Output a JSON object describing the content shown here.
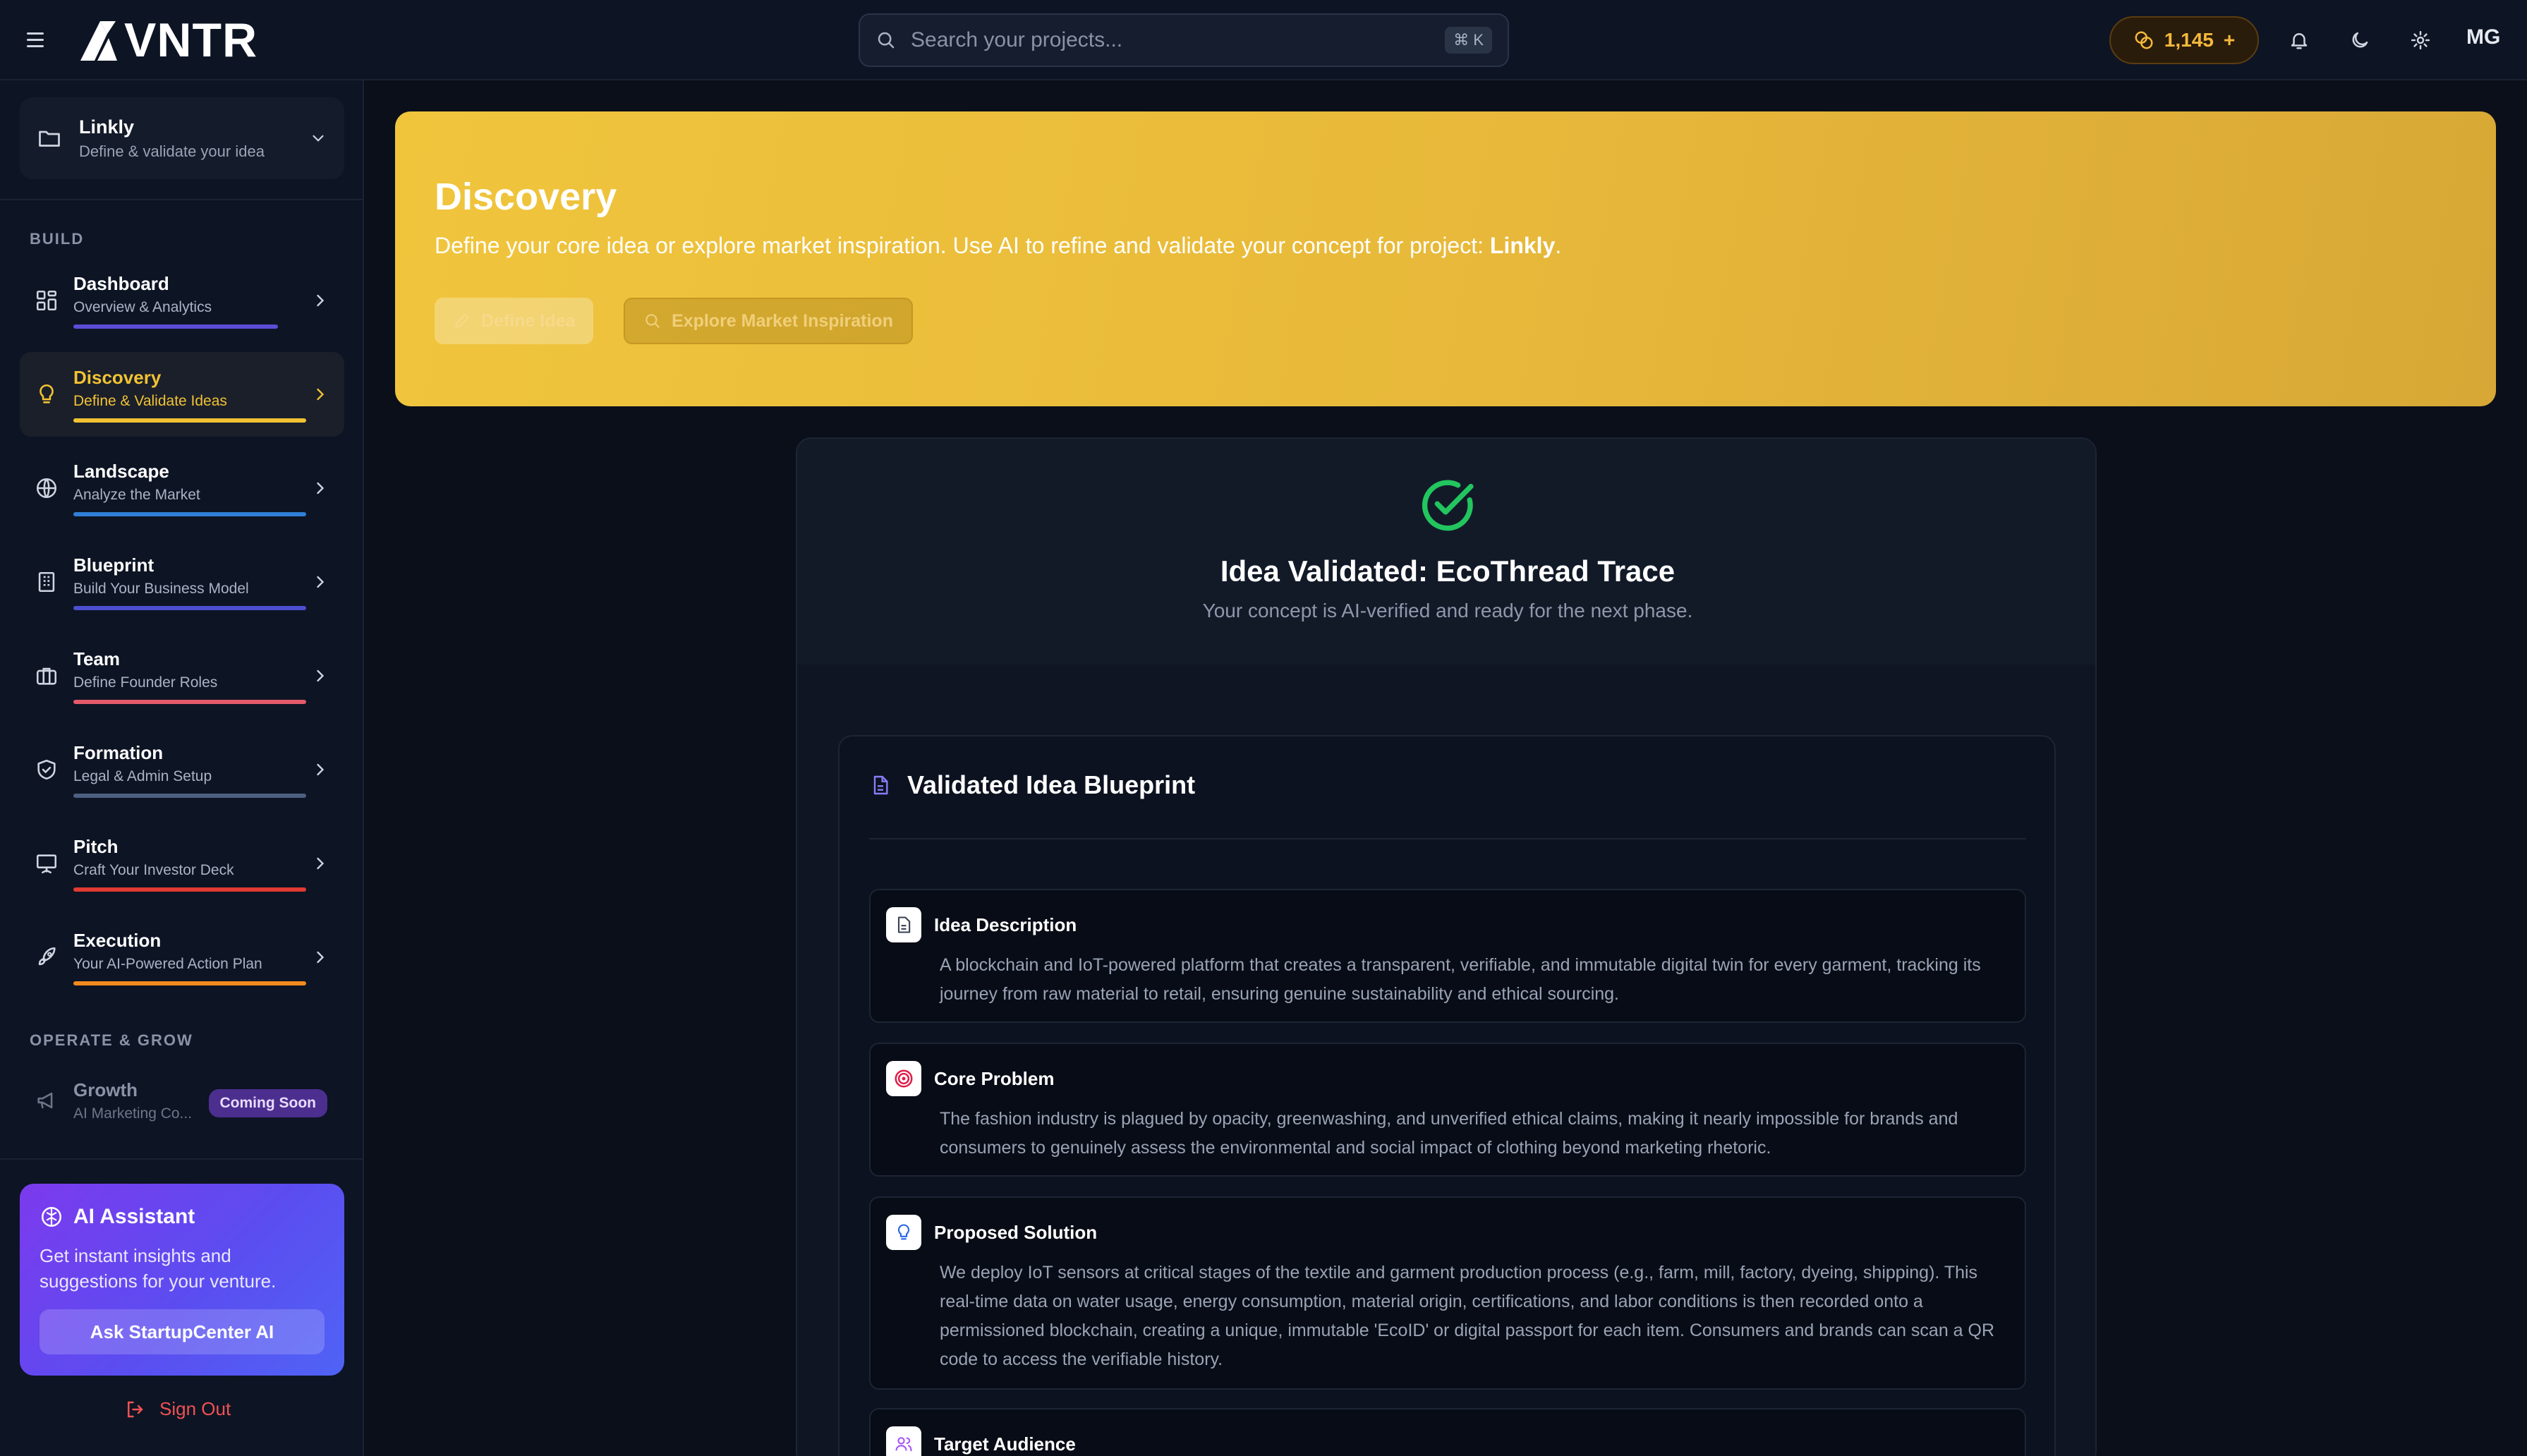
{
  "topbar": {
    "logo": "VNTR",
    "search_placeholder": "Search your projects...",
    "shortcut": "⌘ K",
    "credits": "1,145",
    "credits_plus": "+",
    "avatar": "MG"
  },
  "sidebar": {
    "project": {
      "name": "Linkly",
      "subtitle": "Define & validate your idea"
    },
    "section_build": "BUILD",
    "items": [
      {
        "label": "Dashboard",
        "sub": "Overview & Analytics",
        "color": "#5b4dd6"
      },
      {
        "label": "Discovery",
        "sub": "Define & Validate Ideas",
        "color": "#f2c233"
      },
      {
        "label": "Landscape",
        "sub": "Analyze the Market",
        "color": "#2f7fd6"
      },
      {
        "label": "Blueprint",
        "sub": "Build Your Business Model",
        "color": "#4b4fd0"
      },
      {
        "label": "Team",
        "sub": "Define Founder Roles",
        "color": "#e35a6a"
      },
      {
        "label": "Formation",
        "sub": "Legal & Admin Setup",
        "color": "#4c6080"
      },
      {
        "label": "Pitch",
        "sub": "Craft Your Investor Deck",
        "color": "#e03a32"
      },
      {
        "label": "Execution",
        "sub": "Your AI-Powered Action Plan",
        "color": "#f28a1e"
      }
    ],
    "section_grow": "OPERATE & GROW",
    "growth": {
      "label": "Growth",
      "sub": "AI Marketing Co...",
      "badge": "Coming Soon"
    },
    "ai": {
      "title": "AI Assistant",
      "text": "Get instant insights and suggestions for your venture.",
      "button": "Ask StartupCenter AI"
    },
    "signout": "Sign Out"
  },
  "hero": {
    "title": "Discovery",
    "desc_prefix": "Define your core idea or explore market inspiration. Use AI to refine and validate your concept for project: ",
    "desc_project": "Linkly",
    "desc_suffix": ".",
    "btn_define": "Define Idea",
    "btn_explore": "Explore Market Inspiration"
  },
  "validated": {
    "title": "Idea Validated: EcoThread Trace",
    "subtitle": "Your concept is AI-verified and ready for the next phase.",
    "blueprint_title": "Validated Idea Blueprint",
    "sections": [
      {
        "title": "Idea Description",
        "text": "A blockchain and IoT-powered platform that creates a transparent, verifiable, and immutable digital twin for every garment, tracking its journey from raw material to retail, ensuring genuine sustainability and ethical sourcing."
      },
      {
        "title": "Core Problem",
        "text": "The fashion industry is plagued by opacity, greenwashing, and unverified ethical claims, making it nearly impossible for brands and consumers to genuinely assess the environmental and social impact of clothing beyond marketing rhetoric."
      },
      {
        "title": "Proposed Solution",
        "text": "We deploy IoT sensors at critical stages of the textile and garment production process (e.g., farm, mill, factory, dyeing, shipping). This real-time data on water usage, energy consumption, material origin, certifications, and labor conditions is then recorded onto a permissioned blockchain, creating a unique, immutable 'EcoID' or digital passport for each item. Consumers and brands can scan a QR code to access the verifiable history."
      },
      {
        "title": "Target Audience",
        "text": ""
      }
    ]
  }
}
